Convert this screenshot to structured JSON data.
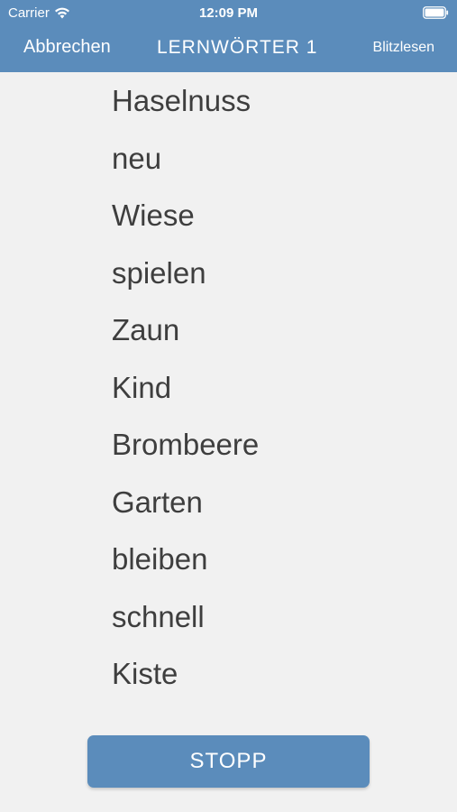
{
  "status_bar": {
    "carrier": "Carrier",
    "time": "12:09 PM",
    "wifi_icon": "wifi-icon",
    "battery_icon": "battery-full-icon"
  },
  "nav": {
    "cancel_label": "Abbrechen",
    "title": "LERNWÖRTER 1",
    "right_label": "Blitzlesen"
  },
  "words": [
    "Haselnuss",
    "neu",
    "Wiese",
    "spielen",
    "Zaun",
    "Kind",
    "Brombeere",
    "Garten",
    "bleiben",
    "schnell",
    "Kiste"
  ],
  "stop_button": {
    "label": "STOPP"
  },
  "colors": {
    "accent": "#5b8cbb",
    "background": "#f1f1f1",
    "text": "#3e3e3e"
  }
}
